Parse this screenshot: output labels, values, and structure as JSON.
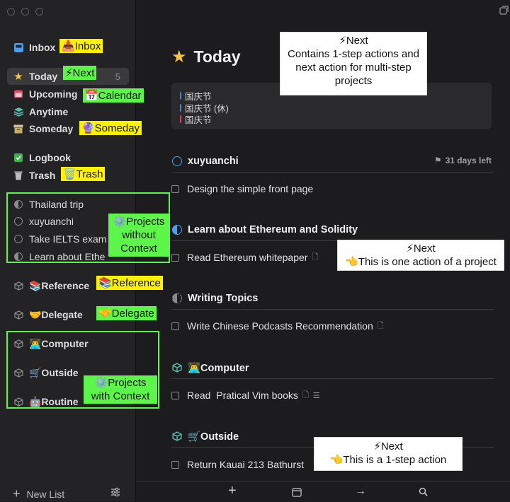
{
  "window": {
    "title": "Today"
  },
  "sidebar": {
    "items": [
      {
        "label": "Inbox",
        "icon": "inbox-icon"
      },
      {
        "label": "Today",
        "icon": "star-icon",
        "count": "5"
      },
      {
        "label": "Upcoming",
        "icon": "calendar-icon"
      },
      {
        "label": "Anytime",
        "icon": "layers-icon"
      },
      {
        "label": "Someday",
        "icon": "archive-box-icon"
      },
      {
        "label": "Logbook",
        "icon": "checkbook-icon"
      },
      {
        "label": "Trash",
        "icon": "trash-icon"
      }
    ],
    "projects": [
      {
        "label": "Thailand trip"
      },
      {
        "label": "xuyuanchi"
      },
      {
        "label": "Take IELTS exam"
      },
      {
        "label": "Learn about Ethe"
      }
    ],
    "areas": [
      {
        "label": "📚Reference"
      },
      {
        "label": "🤝Delegate"
      },
      {
        "label": "👨‍💻Computer"
      },
      {
        "label": "🛒Outside"
      },
      {
        "label": "🤖Routine"
      }
    ],
    "footer": {
      "new_list": "New List"
    }
  },
  "annotations": {
    "inbox": "📥Inbox",
    "next": "⚡Next",
    "calendar": "📅Calendar",
    "someday": "🔮Someday",
    "trash": "🗑️Trash",
    "projects_no_context": [
      "⚙️Projects",
      "without",
      "Context"
    ],
    "reference": "📚Reference",
    "delegate": "🤝Delegate",
    "projects_with_context": [
      "⚙️Projects",
      "with Context"
    ],
    "next_box_top": [
      "⚡Next",
      "Contains 1-step actions and",
      "next action for multi-step",
      "projects"
    ],
    "next_box_mid": [
      "⚡Next",
      "👈This is one action of a project"
    ],
    "next_box_bottom": [
      "⚡Next",
      "👈This is a 1-step action"
    ]
  },
  "main": {
    "title": "Today",
    "calendar_events": [
      {
        "label": "国庆节",
        "color": "#4a7fd6"
      },
      {
        "label": "国庆节 (休)",
        "color": "#4a7fd6"
      },
      {
        "label": "国庆节",
        "color": "#e0455a"
      }
    ],
    "groups": [
      {
        "heading": "xuyuanchi",
        "deadline": "31 days left",
        "tasks": [
          "Design the simple front page"
        ]
      },
      {
        "heading": "Learn about Ethereum and Solidity",
        "tasks": [
          "Read Ethereum whitepaper"
        ]
      },
      {
        "heading": "Writing Topics",
        "tasks": [
          "Write Chinese Podcasts Recommendation"
        ]
      },
      {
        "heading": "👨‍💻Computer",
        "tasks": [
          "Read  Pratical Vim books"
        ]
      },
      {
        "heading": "🛒Outside",
        "tasks": [
          "Return Kauai 213 Bathurst"
        ]
      }
    ]
  },
  "colors": {
    "accent_green": "#5df54a",
    "accent_yellow": "#fff200",
    "project_blue": "#4a9ff5"
  }
}
